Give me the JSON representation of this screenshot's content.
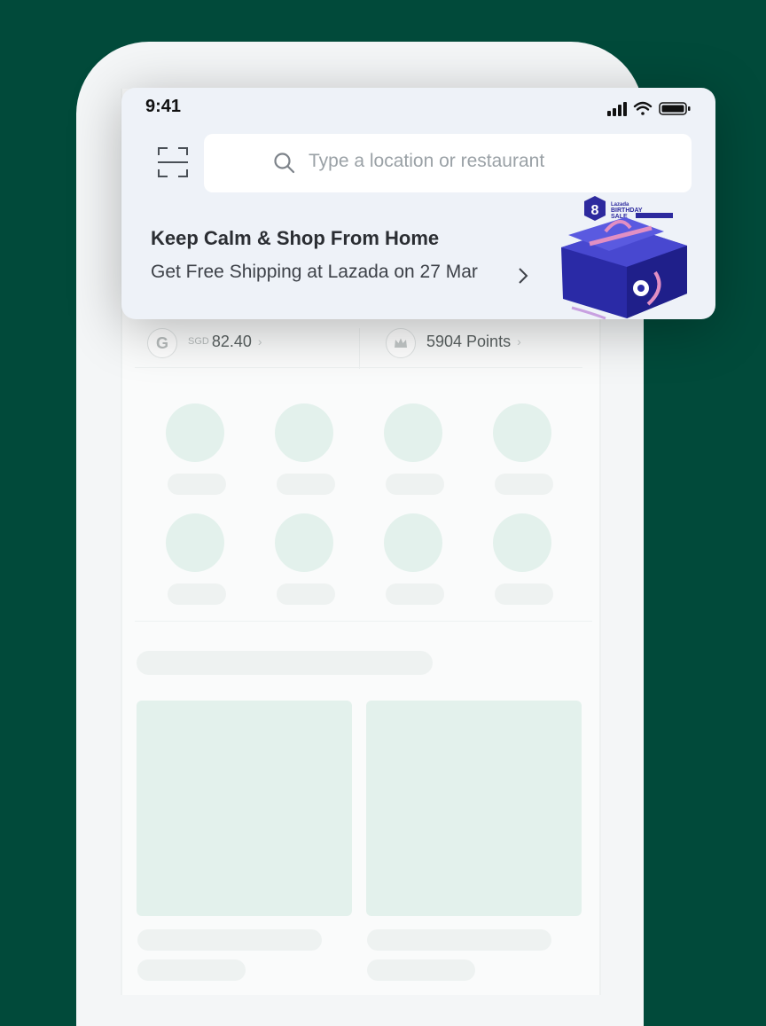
{
  "status_bar": {
    "time": "9:41"
  },
  "search": {
    "placeholder": "Type a location or restaurant"
  },
  "promo": {
    "title": "Keep Calm & Shop From Home",
    "subtitle": "Get Free Shipping at Lazada on 27 Mar",
    "badge_number": "8",
    "badge_brand": "Lazada",
    "badge_line1": "BIRTHDAY",
    "badge_line2": "SALE"
  },
  "wallet": {
    "coin_glyph": "G",
    "currency": "SGD",
    "balance": "82.40",
    "points": "5904 Points",
    "chevron": "›"
  },
  "colors": {
    "background": "#014a3a",
    "placeholder_fill": "#e3f1ec",
    "promo_purple": "#2a2aa6"
  },
  "icons": [
    "scan-icon",
    "search-icon",
    "signal-icon",
    "wifi-icon",
    "battery-icon",
    "chevron-right-icon",
    "crown-icon",
    "gift-box-icon"
  ]
}
